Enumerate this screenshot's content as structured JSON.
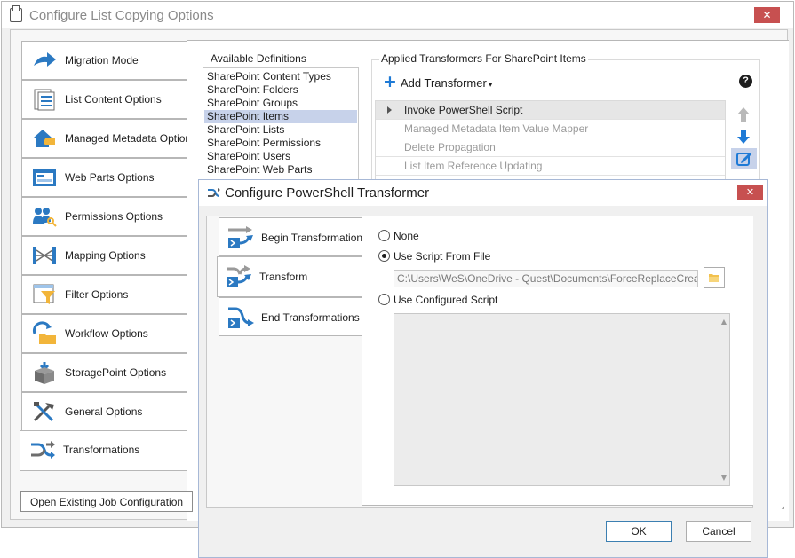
{
  "window": {
    "title": "Configure List Copying Options",
    "close_glyph": "✕"
  },
  "nav": {
    "items": [
      {
        "label": "Migration Mode",
        "icon": "migration-arrow-icon"
      },
      {
        "label": "List Content Options",
        "icon": "list-content-icon"
      },
      {
        "label": "Managed Metadata Options",
        "icon": "managed-metadata-icon"
      },
      {
        "label": "Web Parts Options",
        "icon": "web-parts-icon"
      },
      {
        "label": "Permissions Options",
        "icon": "permissions-icon"
      },
      {
        "label": "Mapping Options",
        "icon": "mapping-icon"
      },
      {
        "label": "Filter Options",
        "icon": "filter-icon"
      },
      {
        "label": "Workflow Options",
        "icon": "workflow-icon"
      },
      {
        "label": "StoragePoint Options",
        "icon": "storagepoint-icon"
      },
      {
        "label": "General Options",
        "icon": "general-tools-icon"
      },
      {
        "label": "Transformations",
        "icon": "transformations-icon"
      }
    ],
    "active_index": 10
  },
  "available_definitions": {
    "label": "Available Definitions",
    "items": [
      "SharePoint Content Types",
      "SharePoint Folders",
      "SharePoint Groups",
      "SharePoint Items",
      "SharePoint Lists",
      "SharePoint Permissions",
      "SharePoint Users",
      "SharePoint Web Parts"
    ],
    "selected_index": 3
  },
  "applied": {
    "label": "Applied Transformers For SharePoint Items",
    "add_label": "Add Transformer",
    "add_caret": "▾",
    "add_glyph": "+",
    "help_glyph": "?",
    "rows": [
      "Invoke PowerShell Script",
      "Managed Metadata Item Value Mapper",
      "Delete Propagation",
      "List Item Reference Updating"
    ],
    "selected_index": 0
  },
  "footer": {
    "open_job_label": "Open Existing Job Configuration"
  },
  "dialog": {
    "title": "Configure PowerShell Transformer",
    "close_glyph": "✕",
    "tabs": [
      {
        "label": "Begin Transformations",
        "icon": "begin-transform-icon"
      },
      {
        "label": "Transform",
        "icon": "transform-icon"
      },
      {
        "label": "End Transformations",
        "icon": "end-transform-icon"
      }
    ],
    "active_tab": 1,
    "options": {
      "none_label": "None",
      "from_file_label": "Use Script From File",
      "configured_label": "Use Configured Script",
      "selected": "from_file"
    },
    "file_path": "C:\\Users\\WeS\\OneDrive - Quest\\Documents\\ForceReplaceCreate...",
    "scroll_up": "▲",
    "scroll_down": "▼",
    "ok_label": "OK",
    "cancel_label": "Cancel"
  },
  "colors": {
    "accent_blue": "#1e7ad6",
    "selection": "#c7d2ea",
    "close_red": "#c75050"
  }
}
